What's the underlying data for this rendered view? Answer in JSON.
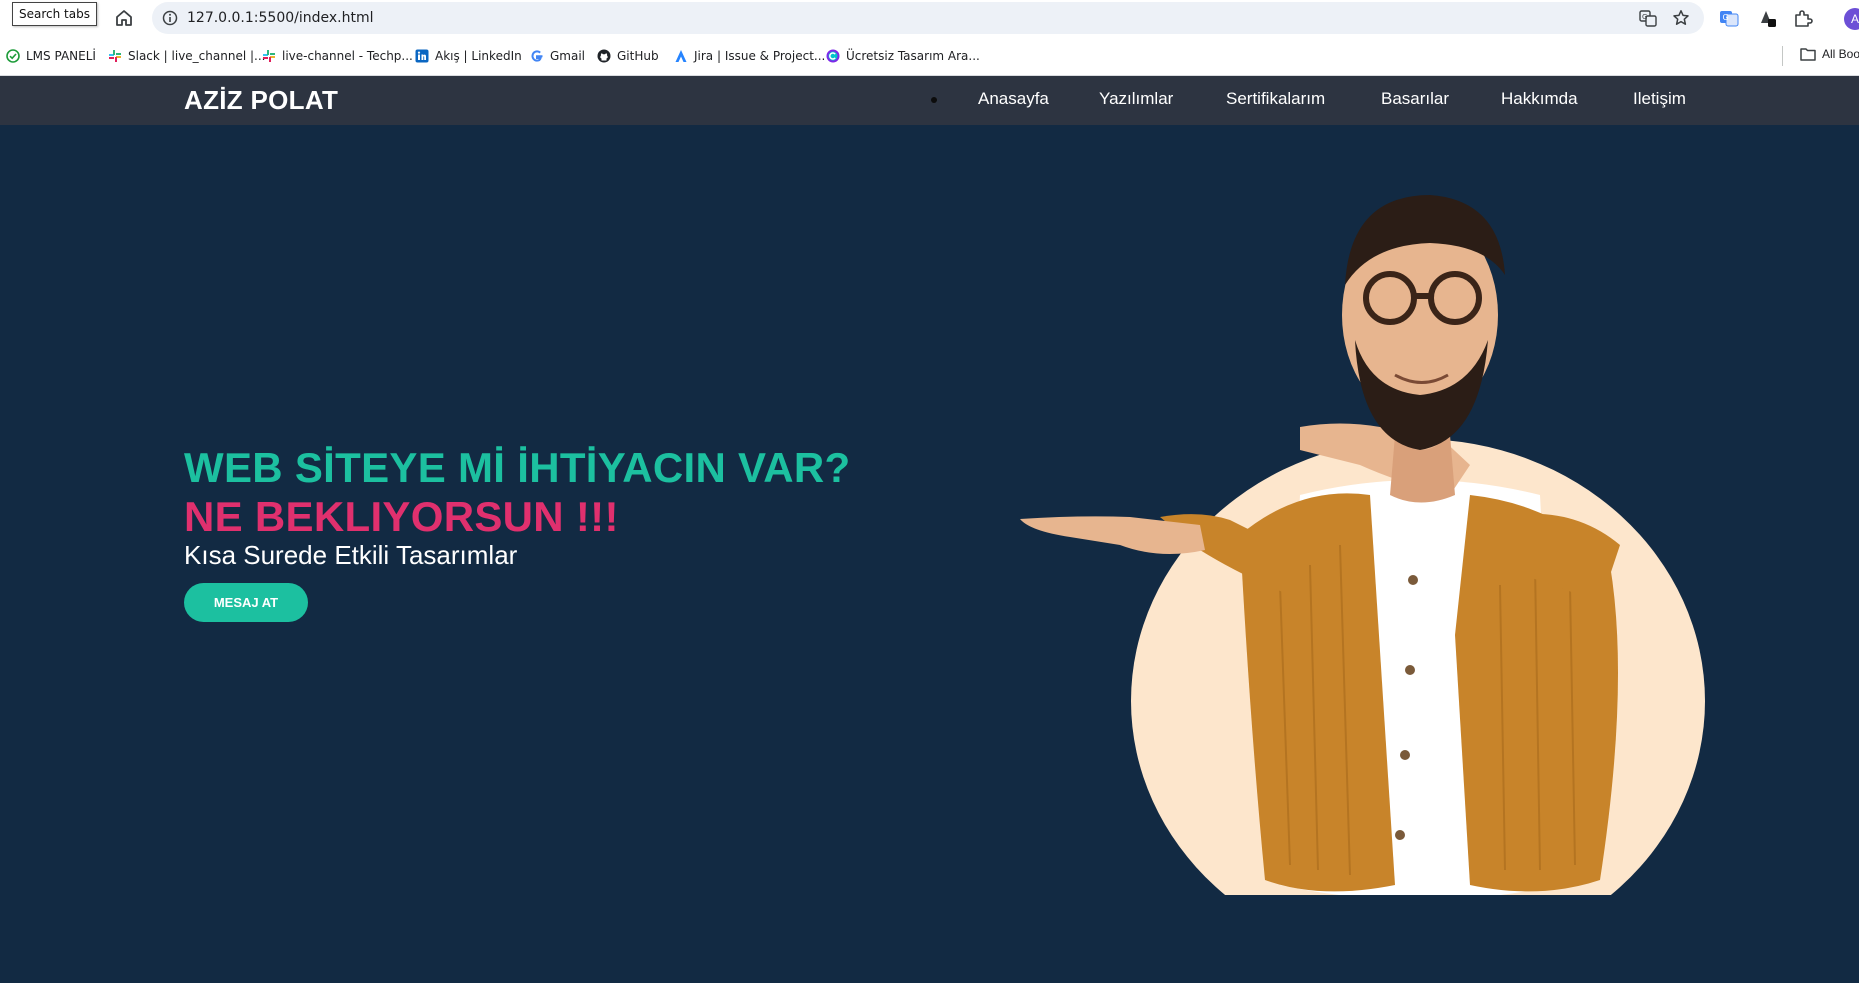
{
  "browser": {
    "tooltip": "Search tabs",
    "url": "127.0.0.1:5500/index.html",
    "avatar_letter": "A",
    "bookmarks": [
      {
        "label": "LMS PANELİ",
        "icon": "check-circle-icon"
      },
      {
        "label": "Slack | live_channel |...",
        "icon": "slack-icon"
      },
      {
        "label": "live-channel - Techp...",
        "icon": "slack-icon"
      },
      {
        "label": "Akış | LinkedIn",
        "icon": "linkedin-icon"
      },
      {
        "label": "Gmail",
        "icon": "google-icon"
      },
      {
        "label": "GitHub",
        "icon": "github-icon"
      },
      {
        "label": "Jira | Issue & Project...",
        "icon": "jira-icon"
      },
      {
        "label": "Ücretsiz Tasarım Ara...",
        "icon": "canva-icon"
      }
    ],
    "all_bookmarks": "All Boo"
  },
  "navbar": {
    "brand": "AZİZ POLAT",
    "links": [
      "Anasayfa",
      "Yazılımlar",
      "Sertifikalarım",
      "Basarılar",
      "Hakkımda",
      "Iletişim"
    ]
  },
  "hero": {
    "title_line1": "WEB SİTEYE Mİ İHTİYACIN VAR?",
    "title_line2": "NE BEKLIYORSUN !!!",
    "subtitle": "Kısa Surede Etkili Tasarımlar",
    "cta": "MESAJ AT",
    "image": "man-pointing-portrait"
  },
  "colors": {
    "page_bg": "#122a43",
    "navbar_bg": "#2d3441",
    "accent_teal": "#1cc0a0",
    "accent_pink": "#e0306e",
    "portrait_bg": "#fde6cc",
    "jacket": "#c8842a"
  }
}
